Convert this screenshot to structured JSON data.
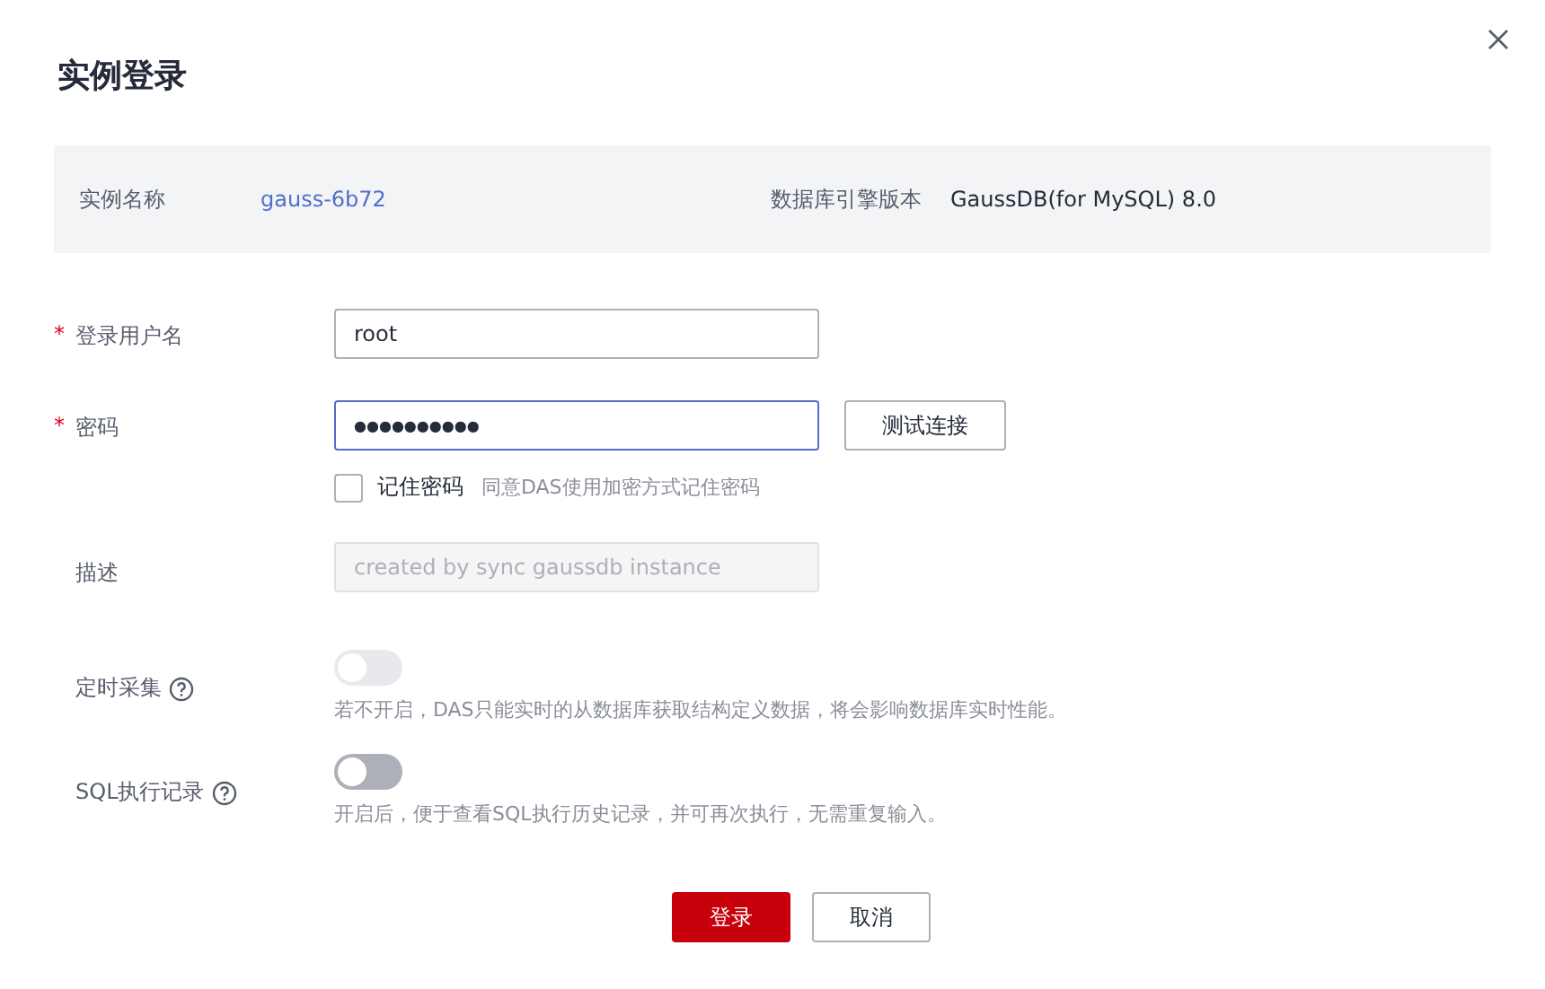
{
  "dialog": {
    "title": "实例登录"
  },
  "info": {
    "instance_label": "实例名称",
    "instance_name": "gauss-6b72",
    "engine_label": "数据库引擎版本",
    "engine_version": "GaussDB(for MySQL) 8.0"
  },
  "form": {
    "username": {
      "label": "登录用户名",
      "required": true,
      "required_mark": "*",
      "value": "root"
    },
    "password": {
      "label": "密码",
      "required": true,
      "required_mark": "*",
      "value": "●●●●●●●●●●",
      "focused": true,
      "test_button": "测试连接"
    },
    "remember": {
      "label": "记住密码",
      "checked": false,
      "hint": "同意DAS使用加密方式记住密码"
    },
    "description": {
      "label": "描述",
      "placeholder": "created by sync gaussdb instance",
      "disabled": true
    },
    "toggles": [
      {
        "label": "定时采集",
        "on": false,
        "disabled": true,
        "hint": "若不开启，DAS只能实时的从数据库获取结构定义数据，将会影响数据库实时性能。"
      },
      {
        "label": "SQL执行记录",
        "on": false,
        "disabled": false,
        "hint": "开启后，便于查看SQL执行历史记录，并可再次执行，无需重复输入。"
      }
    ]
  },
  "buttons": {
    "primary": "登录",
    "secondary": "取消"
  }
}
